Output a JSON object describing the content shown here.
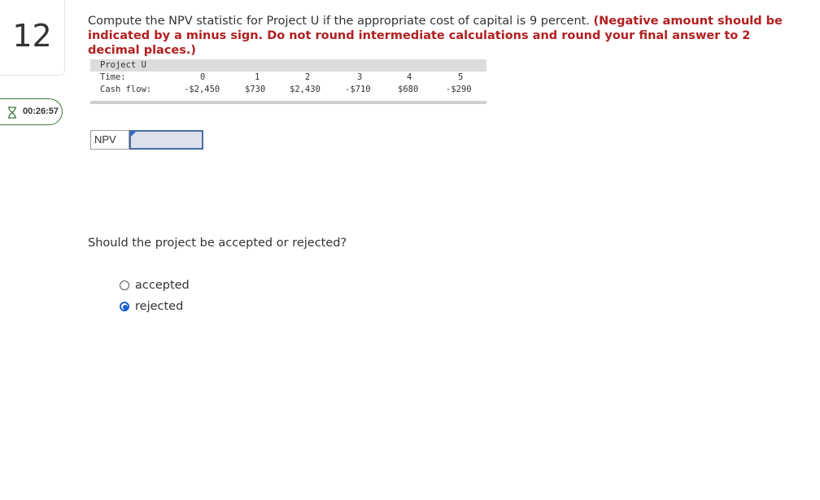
{
  "question": {
    "number": "12",
    "prompt_text": "Compute the NPV statistic for Project U if the appropriate cost of capital is 9 percent.",
    "instruction": "(Negative amount should be indicated by a minus sign. Do not round intermediate calculations and round your final answer to 2 decimal places.)"
  },
  "timer": {
    "icon": "hourglass-icon",
    "value": "00:26:57"
  },
  "cash_flow_table": {
    "title": "Project U",
    "time_label": "Time:",
    "cash_flow_label": "Cash flow:",
    "periods": [
      "0",
      "1",
      "2",
      "3",
      "4",
      "5"
    ],
    "cash_flows": [
      "-$2,450",
      "$730",
      "$2,430",
      "-$710",
      "$680",
      "-$290"
    ]
  },
  "npv": {
    "label": "NPV",
    "value": ""
  },
  "decision": {
    "question": "Should the project be accepted or rejected?",
    "options": [
      {
        "label": "accepted",
        "selected": false
      },
      {
        "label": "rejected",
        "selected": true
      }
    ]
  },
  "colors": {
    "emphasis": "#b21f1f",
    "radio_selected": "#1a5fd1",
    "timer_border": "#3f7a3f",
    "input_border": "#4a6ea8"
  }
}
